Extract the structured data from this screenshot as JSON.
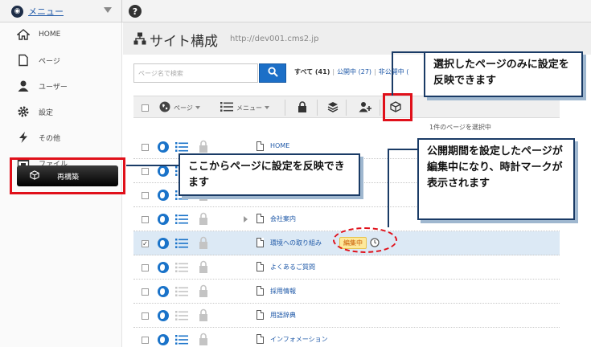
{
  "topbar": {
    "menu_label": "メニュー",
    "help_glyph": "?"
  },
  "sidebar": {
    "items": [
      {
        "label": "HOME",
        "icon": "home-icon"
      },
      {
        "label": "ページ",
        "icon": "page-icon"
      },
      {
        "label": "ユーザー",
        "icon": "user-icon"
      },
      {
        "label": "設定",
        "icon": "gear-icon"
      },
      {
        "label": "その他",
        "icon": "lightning-icon"
      },
      {
        "label": "ファイル",
        "icon": "file-icon"
      }
    ],
    "rebuild_label": "再構築"
  },
  "header": {
    "title": "サイト構成",
    "url": "http://dev001.cms2.jp"
  },
  "search": {
    "placeholder": "ページ名で検索"
  },
  "filters": {
    "all": "すべて (41)",
    "published": "公開中 (27)",
    "unpublished": "非公開中 ("
  },
  "toolbar": {
    "page_label": "ページ",
    "menu_label": "メニュー"
  },
  "selected_count": "1件のページを選択中",
  "rows": [
    {
      "title": "HOME",
      "checked": false,
      "expandable": false
    },
    {
      "title": "",
      "checked": false,
      "expandable": false
    },
    {
      "title": "",
      "checked": false,
      "expandable": false
    },
    {
      "title": "会社案内",
      "checked": false,
      "expandable": true
    },
    {
      "title": "環境への取り組み",
      "checked": true,
      "expandable": false,
      "badge": "編集中"
    },
    {
      "title": "よくあるご質問",
      "checked": false,
      "expandable": false
    },
    {
      "title": "採用情報",
      "checked": false,
      "expandable": false
    },
    {
      "title": "用語辞典",
      "checked": false,
      "expandable": false
    },
    {
      "title": "インフォメーション",
      "checked": false,
      "expandable": false
    }
  ],
  "callouts": {
    "sync_selected": "選択したページのみに設定を反映できます",
    "rebuild": "ここからページに設定を反映できます",
    "editing": "公開期間を設定したページが編集中になり、時計マークが表示されます"
  },
  "colors": {
    "accent_red": "#e0101a",
    "link_blue": "#1f59a8",
    "callout_border": "#1a3b66",
    "search_blue": "#1c6fc7"
  }
}
